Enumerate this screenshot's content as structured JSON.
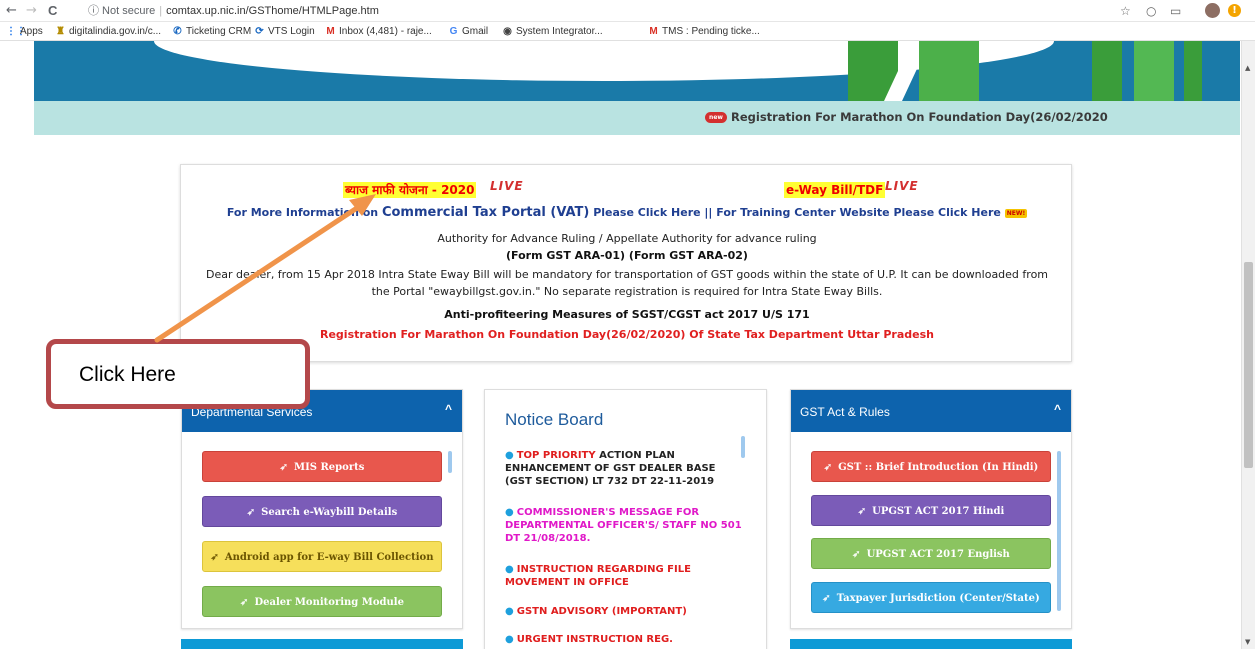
{
  "browser": {
    "back": "←",
    "forward": "→",
    "reload": "C",
    "security": "ⓘ Not secure",
    "url": "comtax.up.nic.in/GSThome/HTMLPage.htm",
    "star": "☆"
  },
  "bookmarks": [
    {
      "icon": "grid",
      "label": "Apps"
    },
    {
      "icon": "emblem",
      "label": "digitalindia.gov.in/c..."
    },
    {
      "icon": "phone",
      "label": "Ticketing CRM"
    },
    {
      "icon": "vts",
      "label": "VTS Login"
    },
    {
      "icon": "gmail",
      "label": "Inbox (4,481) - raje..."
    },
    {
      "icon": "google",
      "label": "Gmail"
    },
    {
      "icon": "globe",
      "label": "System Integrator..."
    },
    {
      "icon": "gmail",
      "label": "TMS : Pending ticke..."
    }
  ],
  "ticker": {
    "badge": "new",
    "text": "Registration For Marathon On Foundation Day(26/02/2020"
  },
  "info": {
    "scheme_hindi": "ब्याज माफी योजना - 2020",
    "live1": "LIVE",
    "eway": "e-Way Bill/TDF",
    "live2": "LIVE",
    "more_info_prefix": "For More Information on ",
    "portal": "Commercial Tax Portal (VAT)",
    "click_here1": " Please Click Here || For Training Center Website Please Click Here ",
    "new_tag": "NEW!",
    "authority": "Authority for Advance Ruling / Appellate Authority for advance ruling",
    "forms": "(Form GST ARA-01)   (Form GST ARA-02)",
    "eway_note_1": "Dear dealer, from 15 Apr 2018 Intra State Eway Bill will be mandatory for transportation of GST goods within the state of U.P. It can be downloaded from",
    "eway_note_2": "the Portal \"ewaybillgst.gov.in.\" No separate registration is required for Intra State Eway Bills.",
    "anti_profit": "Anti-profiteering Measures of SGST/CGST act 2017 U/S 171",
    "marathon": "Registration For Marathon On Foundation Day(26/02/2020) Of State Tax Department Uttar Pradesh"
  },
  "callout": {
    "text": "Click Here",
    "color": "#b4484a",
    "arrow_color": "#f0944a"
  },
  "departmental": {
    "title": "Departmental Services",
    "chevron": "^",
    "buttons": [
      "MIS Reports",
      "Search e-Waybill Details",
      "Android app for E-way Bill Collection",
      "Dealer Monitoring Module"
    ]
  },
  "notice": {
    "title": "Notice Board",
    "items": [
      {
        "highlight": "TOP PRIORITY",
        "text": " ACTION PLAN ENHANCEMENT OF GST DEALER BASE (GST SECTION) LT  732 DT 22-11-2019"
      },
      {
        "text": "COMMISSIONER'S MESSAGE FOR DEPARTMENTAL OFFICER'S/ STAFF NO 501 DT 21/08/2018."
      },
      {
        "text": "INSTRUCTION REGARDING FILE MOVEMENT IN OFFICE"
      },
      {
        "text": "GSTN ADVISORY (IMPORTANT)"
      },
      {
        "text": "URGENT INSTRUCTION REG."
      }
    ]
  },
  "gst_rules": {
    "title": "GST Act & Rules",
    "chevron": "^",
    "buttons": [
      "GST :: Brief Introduction (In Hindi)",
      "UPGST ACT 2017 Hindi",
      "UPGST ACT 2017 English",
      "Taxpayer Jurisdiction (Center/State)"
    ]
  }
}
